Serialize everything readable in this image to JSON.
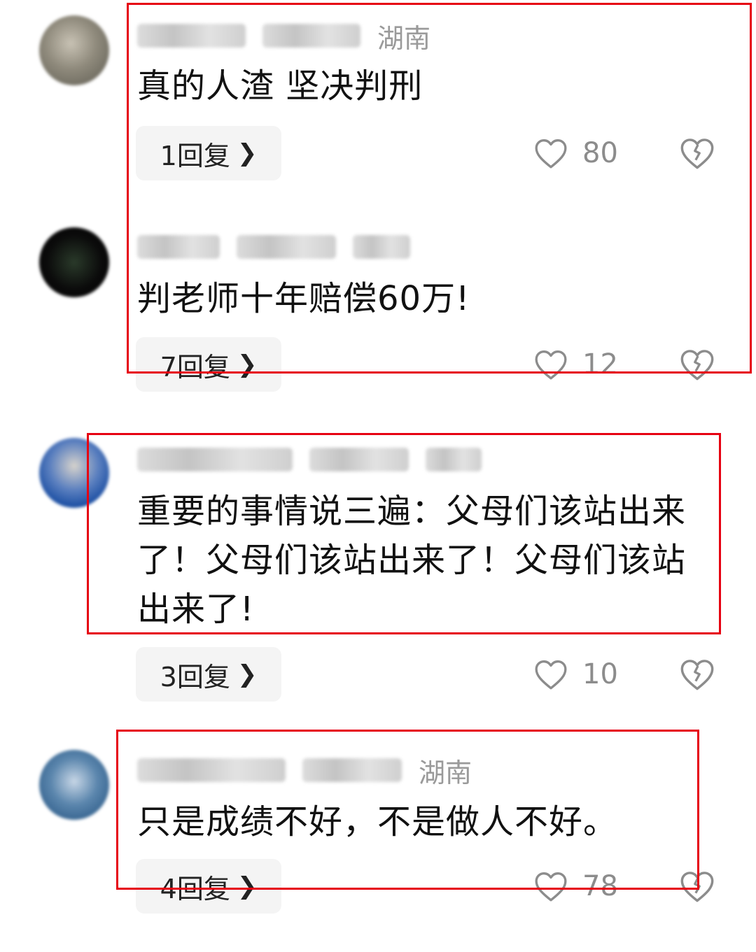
{
  "comments": [
    {
      "region": "湖南",
      "text": "真的人渣 坚决判刑",
      "reply_count": "1回复",
      "likes": "80"
    },
    {
      "region": "",
      "text": "判老师十年赔偿60万!",
      "reply_count": "7回复",
      "likes": "12"
    },
    {
      "region": "",
      "text": "重要的事情说三遍：父母们该站出来了！父母们该站出来了！父母们该站出来了!",
      "reply_count": "3回复",
      "likes": "10"
    },
    {
      "region": "湖南",
      "text": "只是成绩不好，不是做人不好。",
      "reply_count": "4回复",
      "likes": "78"
    }
  ],
  "icons": {
    "reply_chevron": "chevron-right-icon",
    "like": "heart-outline-icon",
    "dislike": "broken-heart-icon"
  },
  "colors": {
    "highlight_box": "#e60012",
    "meta_text": "#9a9a9a",
    "reply_bg": "#f4f4f4"
  }
}
